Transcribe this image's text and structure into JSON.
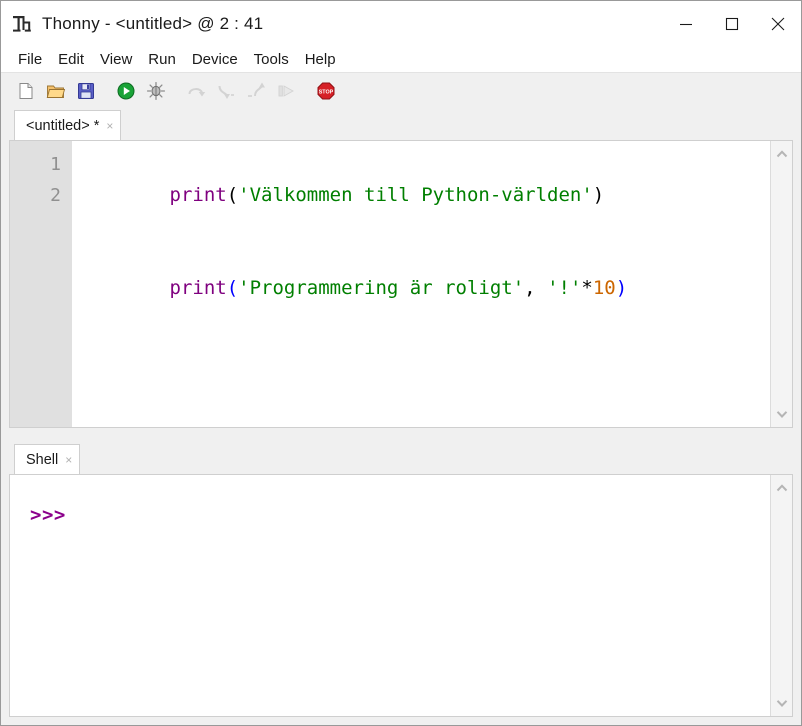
{
  "window": {
    "title": "Thonny  -  <untitled>  @  2 : 41",
    "app_icon": "thonny-logo-icon",
    "controls": {
      "minimize": "minimize-icon",
      "maximize": "maximize-icon",
      "close": "close-icon"
    }
  },
  "menubar": {
    "items": [
      {
        "label": "File"
      },
      {
        "label": "Edit"
      },
      {
        "label": "View"
      },
      {
        "label": "Run"
      },
      {
        "label": "Device"
      },
      {
        "label": "Tools"
      },
      {
        "label": "Help"
      }
    ]
  },
  "toolbar": {
    "buttons": [
      {
        "name": "new-file-icon",
        "title": "New",
        "enabled": true
      },
      {
        "name": "open-file-icon",
        "title": "Open",
        "enabled": true
      },
      {
        "name": "save-file-icon",
        "title": "Save",
        "enabled": true
      },
      {
        "name": "run-icon",
        "title": "Run",
        "enabled": true
      },
      {
        "name": "debug-icon",
        "title": "Debug",
        "enabled": true
      },
      {
        "name": "step-over-icon",
        "title": "Step over",
        "enabled": false
      },
      {
        "name": "step-into-icon",
        "title": "Step into",
        "enabled": false
      },
      {
        "name": "step-out-icon",
        "title": "Step out",
        "enabled": false
      },
      {
        "name": "resume-icon",
        "title": "Resume",
        "enabled": false
      },
      {
        "name": "stop-icon",
        "title": "Stop",
        "enabled": true
      }
    ]
  },
  "editor": {
    "tab": {
      "label": "<untitled> *",
      "close_glyph": "×"
    },
    "line_numbers": [
      "1",
      "2"
    ],
    "lines": [
      {
        "number": "1",
        "tokens": [
          {
            "text": "print",
            "type": "kw"
          },
          {
            "text": "(",
            "type": "par"
          },
          {
            "text": "'Välkommen till Python-världen'",
            "type": "str"
          },
          {
            "text": ")",
            "type": "par"
          }
        ]
      },
      {
        "number": "2",
        "tokens": [
          {
            "text": "print",
            "type": "kw"
          },
          {
            "text": "(",
            "type": "mpar"
          },
          {
            "text": "'Programmering är roligt'",
            "type": "str"
          },
          {
            "text": ",",
            "type": "op"
          },
          {
            "text": " ",
            "type": "op"
          },
          {
            "text": "'!'",
            "type": "str"
          },
          {
            "text": "*",
            "type": "op"
          },
          {
            "text": "10",
            "type": "num"
          },
          {
            "text": ")",
            "type": "mpar"
          }
        ]
      }
    ],
    "scrollbar": {
      "up_arrow": "chevron-up-icon",
      "down_arrow": "chevron-down-icon"
    }
  },
  "shell": {
    "tab": {
      "label": "Shell",
      "close_glyph": "×"
    },
    "prompt": ">>>",
    "scrollbar": {
      "up_arrow": "chevron-up-icon",
      "down_arrow": "chevron-down-icon"
    }
  },
  "colors": {
    "keyword": "#7f007f",
    "string": "#007f00",
    "number": "#cc6600",
    "matched_bracket": "#0000ff",
    "prompt": "#8b008b",
    "gutter_bg": "#e0e0e0",
    "chrome_bg": "#f0f0f0"
  }
}
